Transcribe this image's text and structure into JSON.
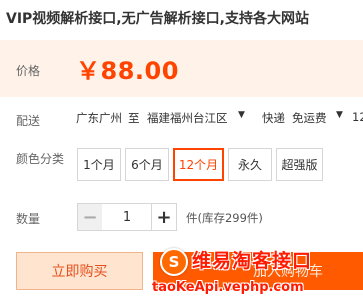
{
  "product": {
    "title": "VIP视频解析接口,无广告解析接口,支持各大网站"
  },
  "price": {
    "label": "价格",
    "value": "￥88.00"
  },
  "shipping": {
    "label": "配送",
    "from": "广东广州",
    "to_word": "至",
    "destination": "福建福州台江区",
    "method": "快递",
    "fee": "免运费",
    "extra": "12",
    "caret_icon": "caret-down-icon"
  },
  "color": {
    "label": "颜色分类",
    "options": [
      "1个月",
      "6个月",
      "12个月",
      "永久",
      "超强版"
    ],
    "selected_index": 2
  },
  "quantity": {
    "label": "数量",
    "value": "1",
    "minus": "−",
    "plus": "+",
    "stock": "件(库存299件)"
  },
  "buttons": {
    "buy_now": "立即购买",
    "add_to_cart": "加入购物车"
  },
  "watermark": {
    "icon": "logo-icon",
    "icon_glyph": "S",
    "title": "维易淘客接口",
    "url": "taoKeApi.vephp.com"
  },
  "colors": {
    "accent": "#ff4400",
    "price_bg": "#fff2e8",
    "cart_bg": "#ff5a00",
    "buy_bg": "#ffe4d0"
  }
}
